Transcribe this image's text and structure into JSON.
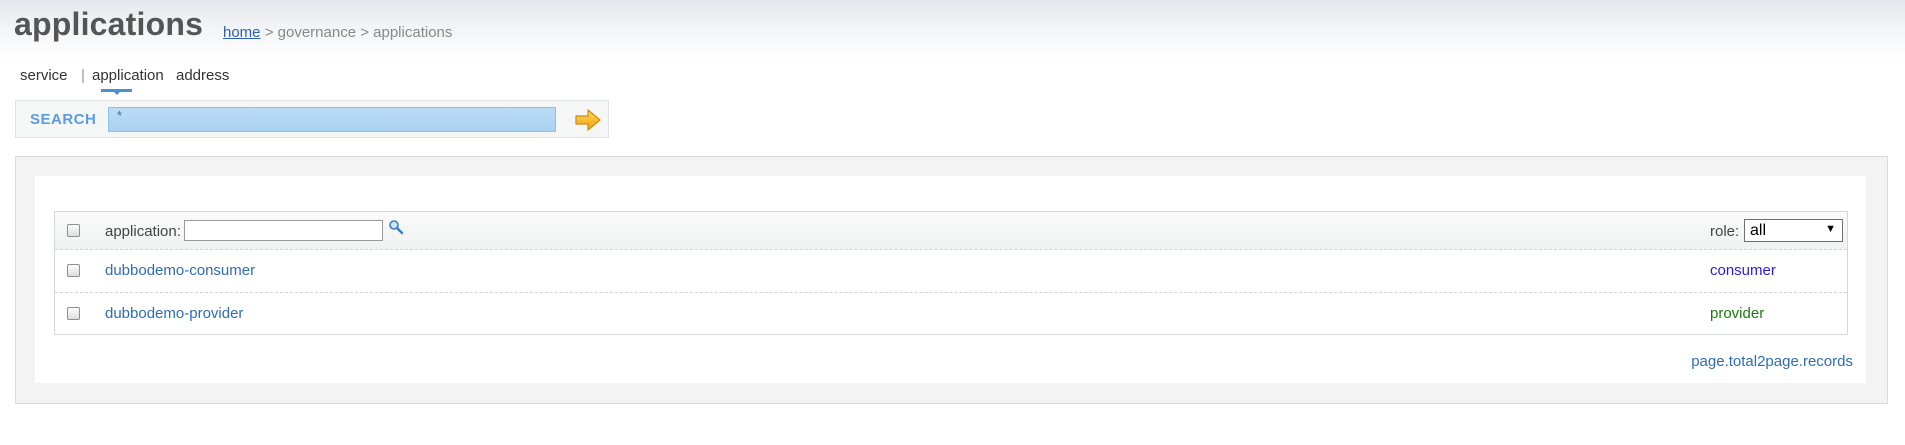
{
  "page": {
    "title": "applications"
  },
  "breadcrumb": {
    "home": "home",
    "separator": ">",
    "middle": "governance",
    "current": "applications"
  },
  "tabs": [
    {
      "label": "service"
    },
    {
      "label": "|"
    },
    {
      "label": "application",
      "active": true
    },
    {
      "label": "address"
    }
  ],
  "search": {
    "label": "SEARCH",
    "value": "*",
    "go_icon": "arrow-right-icon"
  },
  "table": {
    "filter_label": "application:",
    "filter_value": "",
    "filter_icon": "magnifier-icon",
    "role_label": "role:",
    "role_selected": "all",
    "rows": [
      {
        "application": "dubbodemo-consumer",
        "role": "consumer",
        "role_color": "#2b1ed8"
      },
      {
        "application": "dubbodemo-provider",
        "role": "provider",
        "role_color": "#1e7a12"
      }
    ]
  },
  "pager": {
    "text": "page.total2page.records"
  },
  "colors": {
    "link": "#2f6db3",
    "search_label": "#5b9be0",
    "arrow": "#f2b51c"
  }
}
